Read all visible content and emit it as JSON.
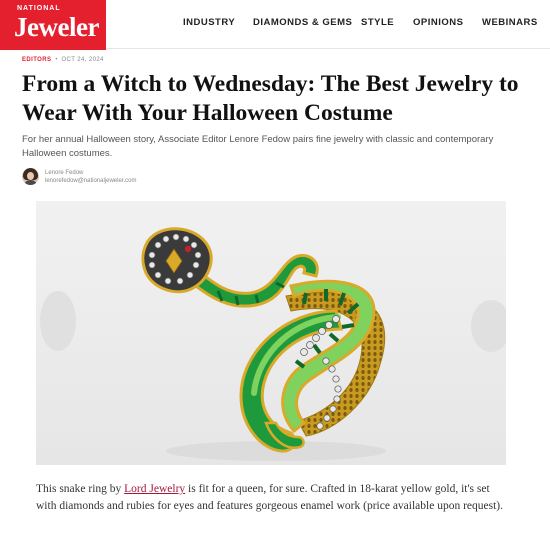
{
  "header": {
    "logo_top": "NATIONAL",
    "logo_main": "Jeweler",
    "nav": [
      {
        "label": "INDUSTRY"
      },
      {
        "label": "DIAMONDS & GEMS"
      },
      {
        "label": "STYLE"
      },
      {
        "label": "OPINIONS"
      },
      {
        "label": "WEBINARS"
      }
    ]
  },
  "article": {
    "category": "EDITORS",
    "date": "OCT 24, 2024",
    "title": "From a Witch to Wednesday: The Best Jewelry to Wear With Your Halloween Costume",
    "subtitle": "For her annual Halloween story, Associate Editor Lenore Fedow pairs fine jewelry with classic and contemporary Halloween costumes.",
    "author": {
      "name": "Lenore Fedow",
      "email": "lenorefedow@nationaljeweler.com"
    },
    "caption": {
      "before": "This snake ring by ",
      "link": "Lord Jewelry",
      "after": " is fit for a queen, for sure. Crafted in 18-karat yellow gold, it's set with diamonds and rubies for eyes and features gorgeous enamel work (price available upon request)."
    }
  },
  "colors": {
    "brand_red": "#e4202f",
    "link": "#a3183a",
    "enamel_green": "#1e9a3c",
    "enamel_light_green": "#7fd25e",
    "gold": "#d9a92a"
  }
}
